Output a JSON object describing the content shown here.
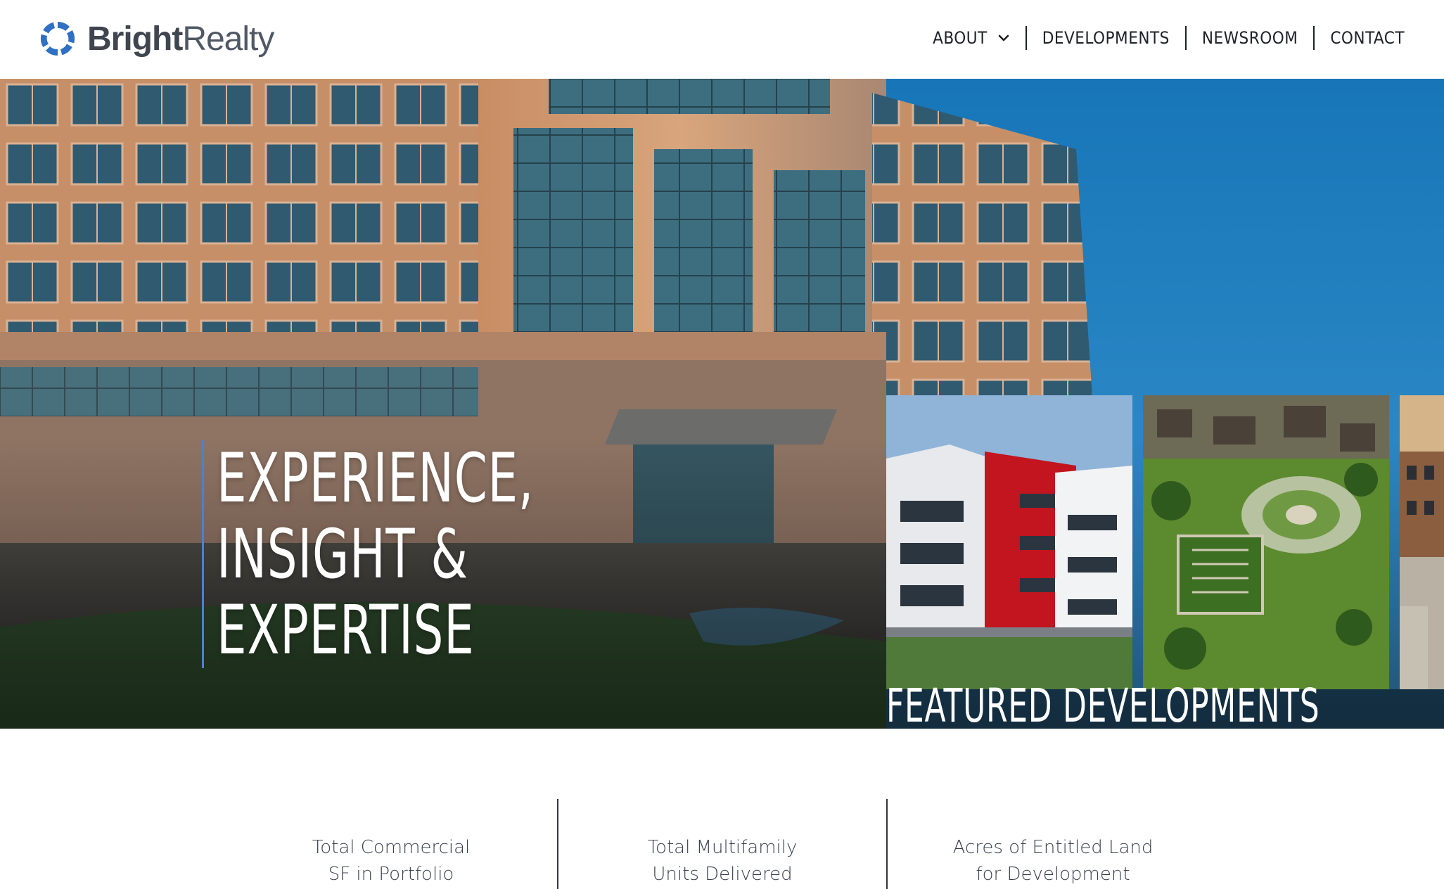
{
  "brand": {
    "name_bold": "Bright",
    "name_light": "Realty",
    "logo_icon": "bright-realty-swirl-logo",
    "accent": "#2f6fc4"
  },
  "nav": {
    "items": [
      {
        "label": "ABOUT",
        "has_dropdown": true
      },
      {
        "label": "DEVELOPMENTS"
      },
      {
        "label": "NEWSROOM"
      },
      {
        "label": "CONTACT"
      }
    ]
  },
  "hero": {
    "headline": [
      "EXPERIENCE,",
      "INSIGHT &",
      "EXPERTISE"
    ],
    "accent_line_color": "#4e7fd0",
    "featured_title": "FEATURED DEVELOPMENTS"
  },
  "stats": [
    {
      "line1": "Total Commercial",
      "line2": "SF in Portfolio"
    },
    {
      "line1": "Total Multifamily",
      "line2": "Units Delivered"
    },
    {
      "line1": "Acres of Entitled Land",
      "line2": "for Development"
    }
  ]
}
